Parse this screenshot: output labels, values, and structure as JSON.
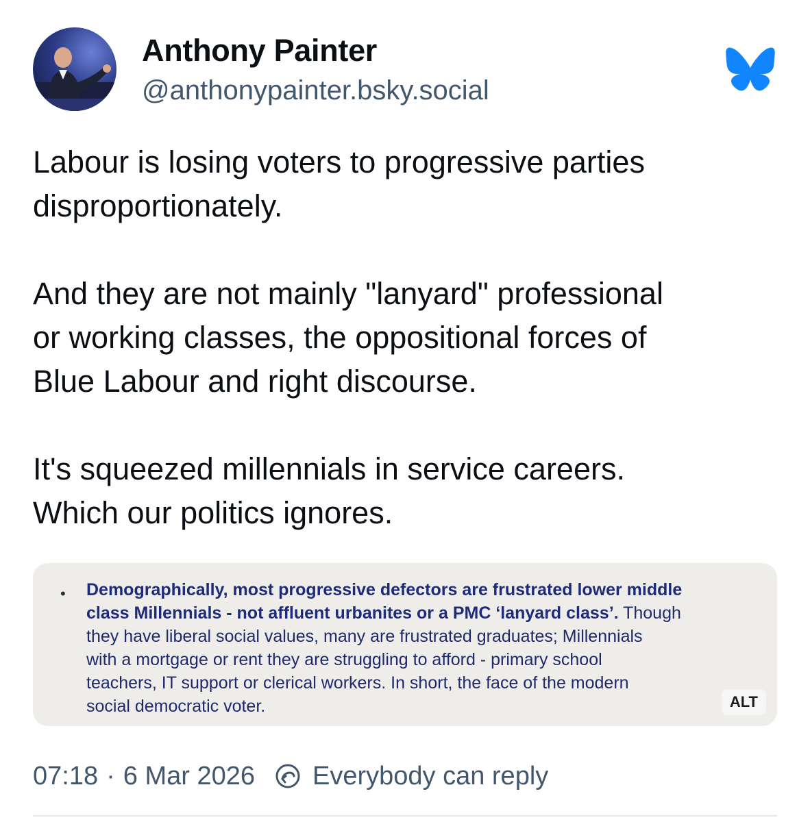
{
  "author": {
    "display_name": "Anthony Painter",
    "handle": "@anthonypainter.bsky.social"
  },
  "post": {
    "paragraphs": [
      [
        "Labour is losing voters to progressive parties",
        "disproportionately."
      ],
      [
        "And they are not mainly \"lanyard\" professional",
        "or working classes, the oppositional forces of",
        "Blue Labour and right discourse."
      ],
      [
        "It's squeezed millennials in service careers.",
        "Which our politics ignores."
      ]
    ]
  },
  "embed": {
    "bullet": "•",
    "lines": [
      {
        "bold": "Demographically, most progressive defectors are frustrated lower middle",
        "normal": ""
      },
      {
        "bold": "class Millennials - not affluent urbanites or a PMC ‘lanyard class’.",
        "normal": " Though"
      },
      {
        "bold": "",
        "normal": "they have liberal social values, many are frustrated graduates; Millennials"
      },
      {
        "bold": "",
        "normal": "with a mortgage or rent they are struggling to afford - primary school"
      },
      {
        "bold": "",
        "normal": "teachers, IT support or clerical workers. In short, the face of the modern"
      },
      {
        "bold": "",
        "normal": "social democratic voter."
      }
    ],
    "alt_label": "ALT"
  },
  "meta": {
    "time": "07:18",
    "separator": "·",
    "date": "6 Mar 2026",
    "reply_setting": "Everybody can reply"
  },
  "icons": {
    "logo": "bluesky-butterfly-icon",
    "reply": "reply-permission-icon"
  },
  "colors": {
    "brand_blue": "#1185fe",
    "handle_gray": "#42576c",
    "embed_bg": "#efede9",
    "embed_text_blue": "#1f2a6b"
  }
}
